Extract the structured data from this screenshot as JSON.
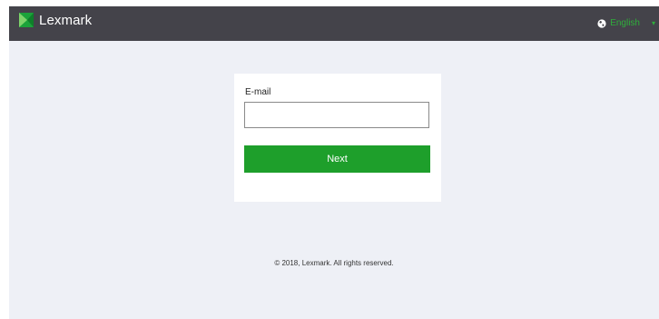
{
  "header": {
    "brand_name": "Lexmark",
    "logo_icon": "lexmark-logo-icon",
    "language": {
      "icon": "globe-icon",
      "label": "English",
      "caret_icon": "chevron-down-icon"
    }
  },
  "login": {
    "email_label": "E-mail",
    "email_value": "",
    "email_placeholder": "",
    "next_label": "Next"
  },
  "footer": {
    "copyright": "© 2018, Lexmark. All rights reserved."
  },
  "colors": {
    "header_bg": "#44434a",
    "page_bg": "#eef0f6",
    "accent_green": "#1e9f2b",
    "language_green": "#2fae3b"
  }
}
